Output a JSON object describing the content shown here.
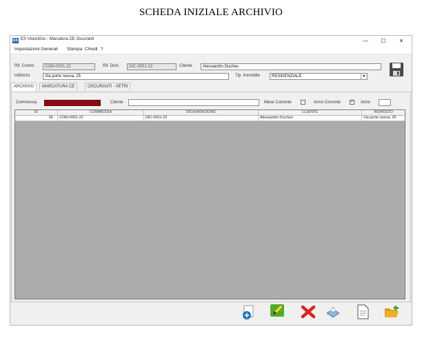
{
  "document": {
    "title": "SCHEDA INIZIALE ARCHIVIO"
  },
  "window": {
    "icon_text": "ES",
    "title": "ES VisionOsc - Marcatura CE Oscuranti",
    "minimize": "—",
    "maximize": "☐",
    "close": "✕"
  },
  "menu": {
    "items": [
      "Impostazioni Generali",
      "Stampa",
      "Chiudi",
      "?"
    ]
  },
  "header": {
    "rif_comm_label": "Rif. Comm.",
    "rif_comm_value": "COM-0001-22",
    "rif_dich_label": "Rif. Dich.",
    "rif_dich_value": "DIC-0001-22",
    "cliente_label": "Cliente",
    "cliente_value": "Alessandro Duches",
    "indirizzo_label": "Indirizzo",
    "indirizzo_value": "Via porte nuova, 25",
    "tip_immobile_label": "Tip. Immobile",
    "tip_immobile_value": "RESIDENZIALE"
  },
  "tabs": [
    "ARCHIVIO",
    "MARCATURA CE",
    "OSCURANTI - VETRI"
  ],
  "filters": {
    "commessa_label": "Commessa",
    "cliente_label": "Cliente",
    "cliente_value": "",
    "mese_corrente_label": "Mese Corrente",
    "mese_corrente_checked": false,
    "anno_corrente_label": "Anno Corrente",
    "anno_corrente_checked": true,
    "anno_label": "Anno",
    "anno_value": "",
    "commessa_fill_color": "#8e0a12"
  },
  "table": {
    "columns": [
      "ID",
      "COMMESSA",
      "DICHIARAZIONE",
      "CLIENTE",
      "INDIRIZZO"
    ],
    "rows": [
      [
        "65",
        "COM-0001-22",
        "DIC-0001-22",
        "Alessandro Duches",
        "Via porte nuova, 25"
      ]
    ]
  },
  "toolbar": {
    "icons": [
      "add-icon",
      "edit-icon",
      "delete-icon",
      "print-icon",
      "document-icon",
      "open-folder-icon"
    ]
  },
  "colors": {
    "accent_blue": "#2a64b4",
    "delete_red": "#e02020",
    "edit_green": "#4caf2a",
    "folder_yellow": "#f2b124"
  }
}
